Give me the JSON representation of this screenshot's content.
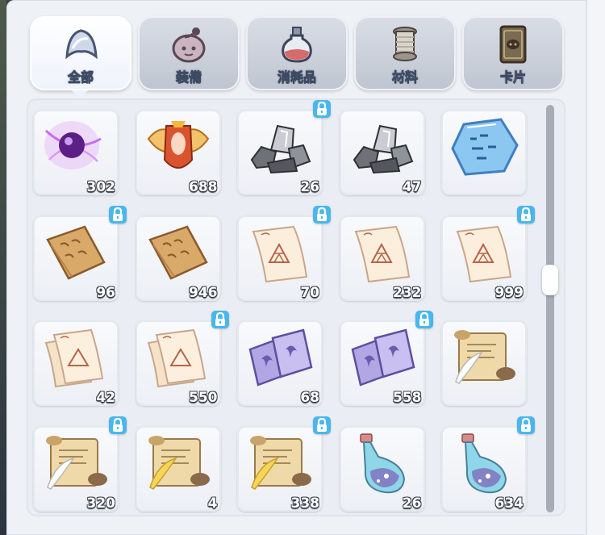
{
  "tabs": [
    {
      "label": "全部",
      "icon": "all-items-icon",
      "active": true
    },
    {
      "label": "装備",
      "icon": "equipment-icon",
      "active": false
    },
    {
      "label": "消耗品",
      "icon": "potion-icon",
      "active": false
    },
    {
      "label": "材料",
      "icon": "thread-spool-icon",
      "active": false
    },
    {
      "label": "卡片",
      "icon": "card-icon",
      "active": false
    }
  ],
  "items": [
    {
      "icon": "purple-orb-icon",
      "qty": "302",
      "locked": false
    },
    {
      "icon": "winged-crest-icon",
      "qty": "688",
      "locked": false
    },
    {
      "icon": "silver-ore-icon",
      "qty": "26",
      "locked": true
    },
    {
      "icon": "silver-ore-icon",
      "qty": "47",
      "locked": false
    },
    {
      "icon": "blue-rune-stone-icon",
      "qty": "",
      "locked": false
    },
    {
      "icon": "wooden-tablet-icon",
      "qty": "96",
      "locked": true
    },
    {
      "icon": "wooden-tablet-icon",
      "qty": "946",
      "locked": false
    },
    {
      "icon": "paper-scroll-icon",
      "qty": "70",
      "locked": true
    },
    {
      "icon": "paper-scroll-icon",
      "qty": "232",
      "locked": false
    },
    {
      "icon": "paper-scroll-icon",
      "qty": "999",
      "locked": true
    },
    {
      "icon": "paper-stack-icon",
      "qty": "42",
      "locked": false
    },
    {
      "icon": "paper-stack-icon",
      "qty": "550",
      "locked": true
    },
    {
      "icon": "purple-card-stack-icon",
      "qty": "68",
      "locked": false
    },
    {
      "icon": "purple-card-stack-icon",
      "qty": "558",
      "locked": true
    },
    {
      "icon": "quill-scroll-icon",
      "qty": "",
      "locked": false
    },
    {
      "icon": "quill-scroll-icon",
      "qty": "320",
      "locked": true
    },
    {
      "icon": "gold-quill-scroll-icon",
      "qty": "4",
      "locked": false
    },
    {
      "icon": "gold-quill-scroll-icon",
      "qty": "338",
      "locked": true
    },
    {
      "icon": "potion-bottle-icon",
      "qty": "26",
      "locked": false
    },
    {
      "icon": "potion-bottle-icon",
      "qty": "634",
      "locked": true
    }
  ],
  "colors": {
    "lock": "#49b7ee",
    "panel": "#eef1f6",
    "tab_label_stroke": "#3d4a63"
  }
}
